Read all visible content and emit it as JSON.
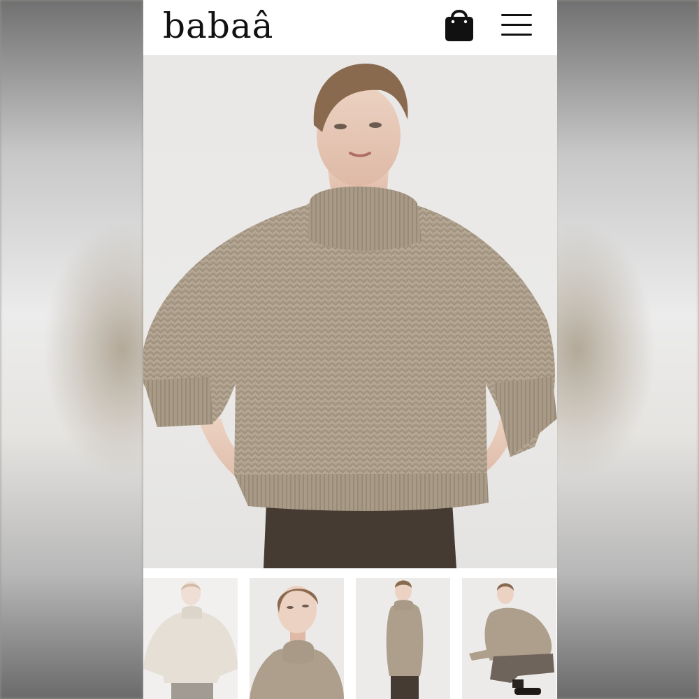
{
  "header": {
    "brand": "babaâ",
    "bag_icon": "shopping-bag-icon",
    "menu_icon": "hamburger-menu-icon"
  },
  "product": {
    "main_image": "model-wearing-oatmeal-chunky-knit-sweater",
    "thumbnails": [
      "front-view-cream-sweater",
      "closeup-front-view",
      "side-view",
      "crouching-pose"
    ]
  },
  "colors": {
    "sweater": "#ad9f8b",
    "skirt": "#463b33",
    "background": "#e9e8e6"
  }
}
